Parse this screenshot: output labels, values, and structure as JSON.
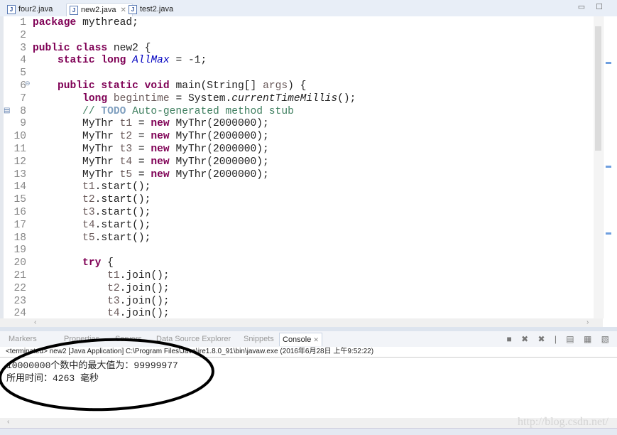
{
  "tabs": [
    {
      "label": "four2.java",
      "icon": "java-file-icon"
    },
    {
      "label": "new2.java",
      "icon": "java-file-icon",
      "active": true,
      "close": "✕"
    },
    {
      "label": "test2.java",
      "icon": "java-file-icon"
    }
  ],
  "window_controls": "▭ ☐",
  "code_lines": [
    [
      [
        "kw",
        "package"
      ],
      [
        "p",
        " mythread;"
      ]
    ],
    [],
    [
      [
        "kw",
        "public"
      ],
      [
        "p",
        " "
      ],
      [
        "kw",
        "class"
      ],
      [
        "p",
        " new2 {"
      ]
    ],
    [
      [
        "p",
        "    "
      ],
      [
        "kw",
        "static"
      ],
      [
        "p",
        " "
      ],
      [
        "kw",
        "long"
      ],
      [
        "p",
        " "
      ],
      [
        "fld",
        "AllMax"
      ],
      [
        "p",
        " = -1;"
      ]
    ],
    [],
    [
      [
        "p",
        "    "
      ],
      [
        "kw",
        "public"
      ],
      [
        "p",
        " "
      ],
      [
        "kw",
        "static"
      ],
      [
        "p",
        " "
      ],
      [
        "kw",
        "void"
      ],
      [
        "p",
        " main(String[] "
      ],
      [
        "var",
        "args"
      ],
      [
        "p",
        ") {"
      ]
    ],
    [
      [
        "p",
        "        "
      ],
      [
        "kw",
        "long"
      ],
      [
        "p",
        " "
      ],
      [
        "var",
        "begintime"
      ],
      [
        "p",
        " = System."
      ],
      [
        "sm",
        "currentTimeMillis"
      ],
      [
        "p",
        "();"
      ]
    ],
    [
      [
        "p",
        "        "
      ],
      [
        "cm",
        "// "
      ],
      [
        "todo",
        "TODO"
      ],
      [
        "cm",
        " Auto-generated method stub"
      ]
    ],
    [
      [
        "p",
        "        MyThr "
      ],
      [
        "var",
        "t1"
      ],
      [
        "p",
        " = "
      ],
      [
        "kw",
        "new"
      ],
      [
        "p",
        " MyThr(2000000);"
      ]
    ],
    [
      [
        "p",
        "        MyThr "
      ],
      [
        "var",
        "t2"
      ],
      [
        "p",
        " = "
      ],
      [
        "kw",
        "new"
      ],
      [
        "p",
        " MyThr(2000000);"
      ]
    ],
    [
      [
        "p",
        "        MyThr "
      ],
      [
        "var",
        "t3"
      ],
      [
        "p",
        " = "
      ],
      [
        "kw",
        "new"
      ],
      [
        "p",
        " MyThr(2000000);"
      ]
    ],
    [
      [
        "p",
        "        MyThr "
      ],
      [
        "var",
        "t4"
      ],
      [
        "p",
        " = "
      ],
      [
        "kw",
        "new"
      ],
      [
        "p",
        " MyThr(2000000);"
      ]
    ],
    [
      [
        "p",
        "        MyThr "
      ],
      [
        "var",
        "t5"
      ],
      [
        "p",
        " = "
      ],
      [
        "kw",
        "new"
      ],
      [
        "p",
        " MyThr(2000000);"
      ]
    ],
    [
      [
        "p",
        "        "
      ],
      [
        "var",
        "t1"
      ],
      [
        "p",
        ".start();"
      ]
    ],
    [
      [
        "p",
        "        "
      ],
      [
        "var",
        "t2"
      ],
      [
        "p",
        ".start();"
      ]
    ],
    [
      [
        "p",
        "        "
      ],
      [
        "var",
        "t3"
      ],
      [
        "p",
        ".start();"
      ]
    ],
    [
      [
        "p",
        "        "
      ],
      [
        "var",
        "t4"
      ],
      [
        "p",
        ".start();"
      ]
    ],
    [
      [
        "p",
        "        "
      ],
      [
        "var",
        "t5"
      ],
      [
        "p",
        ".start();"
      ]
    ],
    [],
    [
      [
        "p",
        "        "
      ],
      [
        "kw",
        "try"
      ],
      [
        "p",
        " {"
      ]
    ],
    [
      [
        "p",
        "            "
      ],
      [
        "var",
        "t1"
      ],
      [
        "p",
        ".join();"
      ]
    ],
    [
      [
        "p",
        "            "
      ],
      [
        "var",
        "t2"
      ],
      [
        "p",
        ".join();"
      ]
    ],
    [
      [
        "p",
        "            "
      ],
      [
        "var",
        "t3"
      ],
      [
        "p",
        ".join();"
      ]
    ],
    [
      [
        "p",
        "            "
      ],
      [
        "var",
        "t4"
      ],
      [
        "p",
        ".join();"
      ]
    ]
  ],
  "console": {
    "tabs": [
      "Markers",
      "Properties",
      "Servers",
      "Data Source Explorer",
      "Snippets",
      "Console"
    ],
    "active_tab": "Console",
    "status": "<terminated> new2 [Java Application] C:\\Program Files\\Java\\jre1.8.0_91\\bin\\javaw.exe (2016年6月28日 上午9:52:22)",
    "output": [
      "10000000个数中的最大值为：99999977",
      "所用时间：4263 毫秒"
    ],
    "tools": "■ ✖ ✖ | ▤ ▦ ▧"
  },
  "watermark": "http://blog.csdn.net/"
}
